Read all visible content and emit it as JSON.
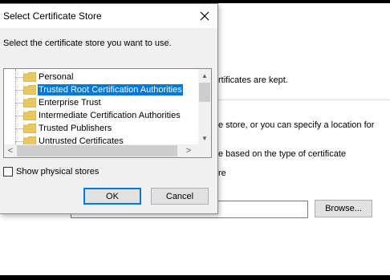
{
  "dialog": {
    "title": "Select Certificate Store",
    "prompt": "Select the certificate store you want to use.",
    "stores": [
      {
        "label": "Personal",
        "selected": false
      },
      {
        "label": "Trusted Root Certification Authorities",
        "selected": true
      },
      {
        "label": "Enterprise Trust",
        "selected": false
      },
      {
        "label": "Intermediate Certification Authorities",
        "selected": false
      },
      {
        "label": "Trusted Publishers",
        "selected": false
      },
      {
        "label": "Untrusted Certificates",
        "selected": false
      }
    ],
    "show_physical_label": "Show physical stores",
    "show_physical_checked": false,
    "ok_label": "OK",
    "cancel_label": "Cancel",
    "scroll_left_arrow": "<",
    "scroll_right_arrow": ">"
  },
  "background": {
    "line1": "rtificates are kept.",
    "line2": "e store, or you can specify a location for",
    "line3": "e based on the type of certificate",
    "line4": "re",
    "path_value": "",
    "browse_label": "Browse..."
  },
  "colors": {
    "selection": "#0078d7",
    "folder": "#e8c766",
    "dialog_bg": "#f0f0f0"
  }
}
